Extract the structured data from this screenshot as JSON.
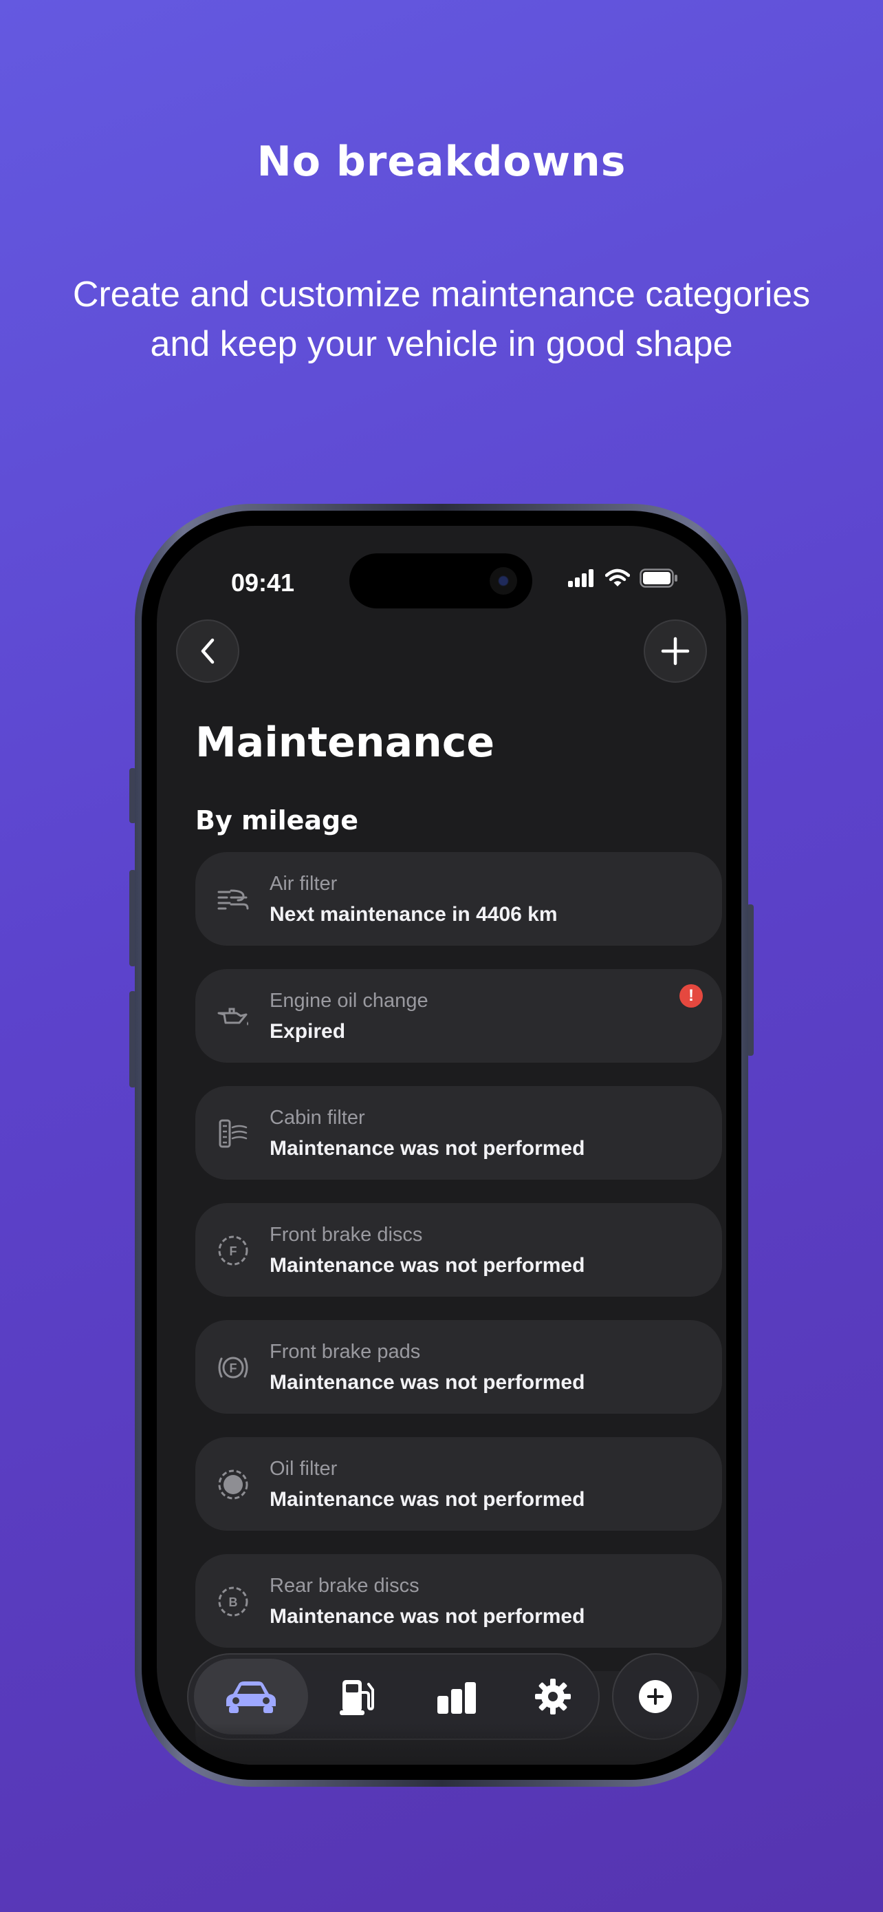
{
  "promo": {
    "headline": "No breakdowns",
    "subline_1": "Create and customize maintenance categories",
    "subline_2": "and keep your vehicle in good shape"
  },
  "status_bar": {
    "time": "09:41"
  },
  "screen": {
    "title": "Maintenance",
    "section": "By mileage",
    "items": [
      {
        "label": "Air filter",
        "status": "Next maintenance in 4406 km",
        "icon": "air-filter-icon",
        "alert": false
      },
      {
        "label": "Engine oil change",
        "status": "Expired",
        "icon": "oil-can-icon",
        "alert": true,
        "alert_symbol": "!"
      },
      {
        "label": "Cabin filter",
        "status": "Maintenance was not performed",
        "icon": "cabin-filter-icon",
        "alert": false
      },
      {
        "label": "Front brake discs",
        "status": "Maintenance was not performed",
        "icon": "brake-disc-front-icon",
        "alert": false
      },
      {
        "label": "Front brake pads",
        "status": "Maintenance was not performed",
        "icon": "brake-pads-front-icon",
        "alert": false
      },
      {
        "label": "Oil filter",
        "status": "Maintenance was not performed",
        "icon": "oil-filter-icon",
        "alert": false
      },
      {
        "label": "Rear brake discs",
        "status": "Maintenance was not performed",
        "icon": "brake-disc-rear-icon",
        "alert": false
      }
    ]
  },
  "tab_bar": {
    "tabs": [
      {
        "name": "garage",
        "icon": "car-icon",
        "active": true
      },
      {
        "name": "fuel",
        "icon": "fuel-pump-icon",
        "active": false
      },
      {
        "name": "statistics",
        "icon": "bar-chart-icon",
        "active": false
      },
      {
        "name": "settings",
        "icon": "gear-icon",
        "active": false
      }
    ],
    "add_icon": "plus-circle-icon"
  },
  "colors": {
    "background_top": "#6459E0",
    "background_bottom": "#5634B0",
    "screen_bg": "#1C1C1E",
    "card_bg": "#2A2A2D",
    "alert": "#E5483F",
    "active_tab_icon": "#9EA8FF"
  }
}
